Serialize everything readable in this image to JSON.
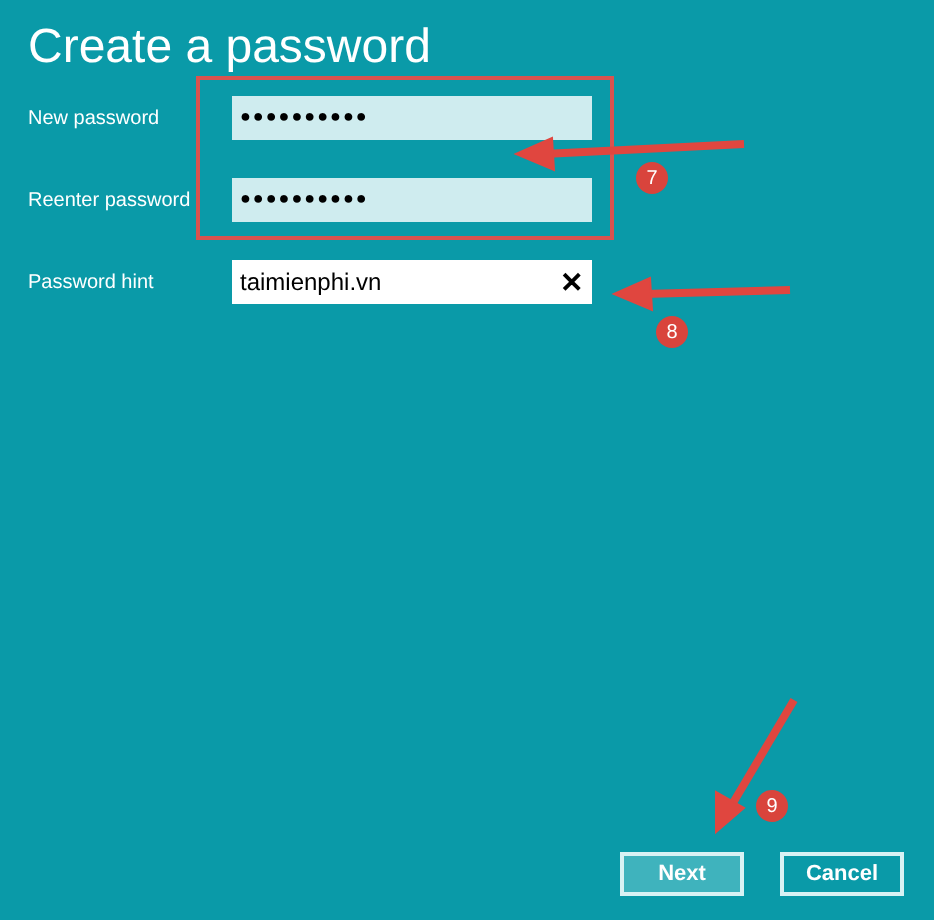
{
  "title": "Create a password",
  "fields": [
    {
      "label": "New password",
      "value": "●●●●●●●●●●",
      "kind": "password"
    },
    {
      "label": "Reenter password",
      "value": "●●●●●●●●●●",
      "kind": "password"
    },
    {
      "label": "Password hint",
      "value": "taimienphi.vn",
      "kind": "text",
      "clear_button": "✕"
    }
  ],
  "buttons": [
    {
      "label": "Next",
      "selected": true
    },
    {
      "label": "Cancel",
      "selected": false
    }
  ],
  "callouts": [
    "7",
    "8",
    "9"
  ]
}
